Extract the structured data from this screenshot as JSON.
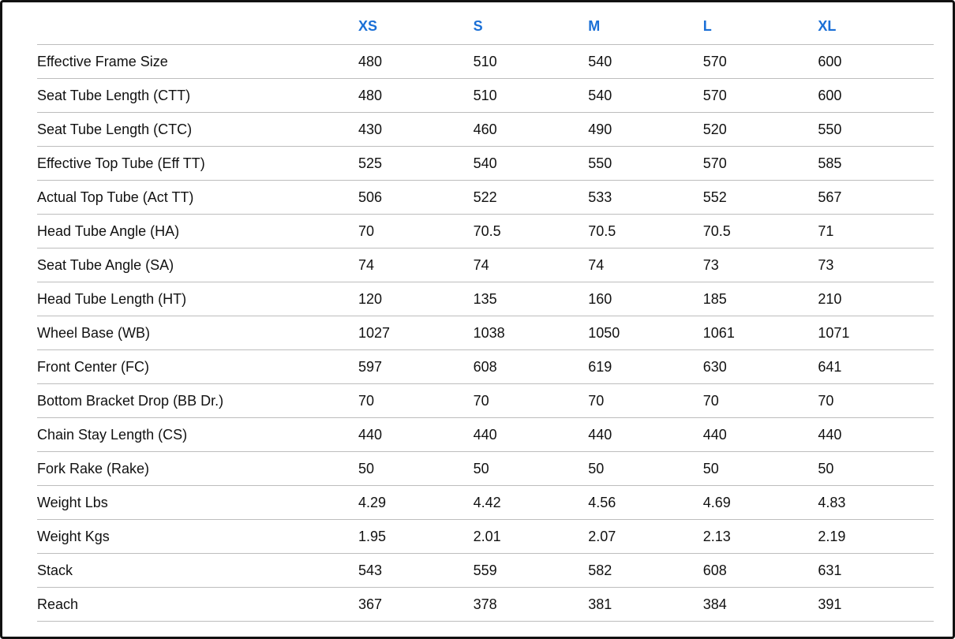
{
  "accent_color": "#1a6fd6",
  "table": {
    "header": {
      "label": "",
      "sizes": [
        "XS",
        "S",
        "M",
        "L",
        "XL"
      ]
    },
    "rows": [
      {
        "label": "Effective Frame Size",
        "values": [
          "480",
          "510",
          "540",
          "570",
          "600"
        ]
      },
      {
        "label": "Seat Tube Length (CTT)",
        "values": [
          "480",
          "510",
          "540",
          "570",
          "600"
        ]
      },
      {
        "label": "Seat Tube Length (CTC)",
        "values": [
          "430",
          "460",
          "490",
          "520",
          "550"
        ]
      },
      {
        "label": "Effective Top Tube (Eff TT)",
        "values": [
          "525",
          "540",
          "550",
          "570",
          "585"
        ]
      },
      {
        "label": "Actual Top Tube (Act TT)",
        "values": [
          "506",
          "522",
          "533",
          "552",
          "567"
        ]
      },
      {
        "label": "Head Tube Angle (HA)",
        "values": [
          "70",
          "70.5",
          "70.5",
          "70.5",
          "71"
        ]
      },
      {
        "label": "Seat Tube Angle (SA)",
        "values": [
          "74",
          "74",
          "74",
          "73",
          "73"
        ]
      },
      {
        "label": "Head Tube Length (HT)",
        "values": [
          "120",
          "135",
          "160",
          "185",
          "210"
        ]
      },
      {
        "label": "Wheel Base (WB)",
        "values": [
          "1027",
          "1038",
          "1050",
          "1061",
          "1071"
        ]
      },
      {
        "label": "Front Center (FC)",
        "values": [
          "597",
          "608",
          "619",
          "630",
          "641"
        ]
      },
      {
        "label": "Bottom Bracket Drop (BB Dr.)",
        "values": [
          "70",
          "70",
          "70",
          "70",
          "70"
        ]
      },
      {
        "label": "Chain Stay Length (CS)",
        "values": [
          "440",
          "440",
          "440",
          "440",
          "440"
        ]
      },
      {
        "label": "Fork Rake (Rake)",
        "values": [
          "50",
          "50",
          "50",
          "50",
          "50"
        ]
      },
      {
        "label": "Weight Lbs",
        "values": [
          "4.29",
          "4.42",
          "4.56",
          "4.69",
          "4.83"
        ]
      },
      {
        "label": "Weight Kgs",
        "values": [
          "1.95",
          "2.01",
          "2.07",
          "2.13",
          "2.19"
        ]
      },
      {
        "label": "Stack",
        "values": [
          "543",
          "559",
          "582",
          "608",
          "631"
        ]
      },
      {
        "label": "Reach",
        "values": [
          "367",
          "378",
          "381",
          "384",
          "391"
        ]
      }
    ]
  }
}
